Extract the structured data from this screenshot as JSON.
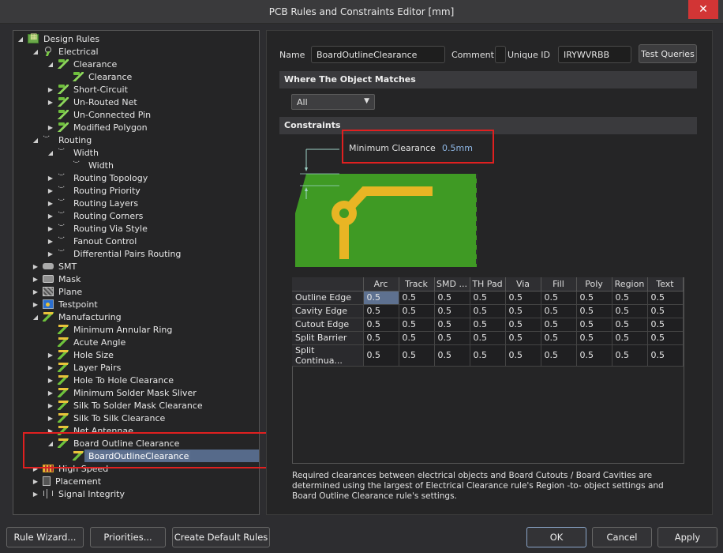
{
  "window": {
    "title": "PCB Rules and Constraints Editor [mm]",
    "close_glyph": "✕"
  },
  "tree": {
    "items": [
      {
        "label": "Design Rules",
        "icon": "design-rules-icon",
        "arrow": "◢"
      },
      {
        "label": "Electrical",
        "icon": "electrical-icon",
        "arrow": "◢"
      },
      {
        "label": "Clearance",
        "icon": "rule-icon",
        "arrow": "◢"
      },
      {
        "label": "Clearance",
        "icon": "rule-icon",
        "arrow": ""
      },
      {
        "label": "Short-Circuit",
        "icon": "rule-icon",
        "arrow": "▶"
      },
      {
        "label": "Un-Routed Net",
        "icon": "rule-icon",
        "arrow": "▶"
      },
      {
        "label": "Un-Connected Pin",
        "icon": "rule-icon",
        "arrow": ""
      },
      {
        "label": "Modified Polygon",
        "icon": "rule-icon",
        "arrow": "▶"
      },
      {
        "label": "Routing",
        "icon": "routing-icon",
        "arrow": "◢"
      },
      {
        "label": "Width",
        "icon": "routing-icon",
        "arrow": "◢"
      },
      {
        "label": "Width",
        "icon": "routing-icon",
        "arrow": ""
      },
      {
        "label": "Routing Topology",
        "icon": "routing-icon",
        "arrow": "▶"
      },
      {
        "label": "Routing Priority",
        "icon": "routing-icon",
        "arrow": "▶"
      },
      {
        "label": "Routing Layers",
        "icon": "routing-icon",
        "arrow": "▶"
      },
      {
        "label": "Routing Corners",
        "icon": "routing-icon",
        "arrow": "▶"
      },
      {
        "label": "Routing Via Style",
        "icon": "routing-icon",
        "arrow": "▶"
      },
      {
        "label": "Fanout Control",
        "icon": "routing-icon",
        "arrow": "▶"
      },
      {
        "label": "Differential Pairs Routing",
        "icon": "routing-icon",
        "arrow": "▶"
      },
      {
        "label": "SMT",
        "icon": "smt-icon",
        "arrow": "▶"
      },
      {
        "label": "Mask",
        "icon": "mask-icon",
        "arrow": "▶"
      },
      {
        "label": "Plane",
        "icon": "plane-icon",
        "arrow": "▶"
      },
      {
        "label": "Testpoint",
        "icon": "testpoint-icon",
        "arrow": "▶"
      },
      {
        "label": "Manufacturing",
        "icon": "manufacturing-icon",
        "arrow": "◢"
      },
      {
        "label": "Minimum Annular Ring",
        "icon": "manufacturing-rule-icon",
        "arrow": ""
      },
      {
        "label": "Acute Angle",
        "icon": "manufacturing-rule-icon",
        "arrow": ""
      },
      {
        "label": "Hole Size",
        "icon": "manufacturing-rule-icon",
        "arrow": "▶"
      },
      {
        "label": "Layer Pairs",
        "icon": "manufacturing-rule-icon",
        "arrow": "▶"
      },
      {
        "label": "Hole To Hole Clearance",
        "icon": "manufacturing-rule-icon",
        "arrow": "▶"
      },
      {
        "label": "Minimum Solder Mask Sliver",
        "icon": "manufacturing-rule-icon",
        "arrow": "▶"
      },
      {
        "label": "Silk To Solder Mask Clearance",
        "icon": "manufacturing-rule-icon",
        "arrow": "▶"
      },
      {
        "label": "Silk To Silk Clearance",
        "icon": "manufacturing-rule-icon",
        "arrow": "▶"
      },
      {
        "label": "Net Antennae",
        "icon": "manufacturing-rule-icon",
        "arrow": "▶"
      },
      {
        "label": "Board Outline Clearance",
        "icon": "manufacturing-rule-icon",
        "arrow": "◢"
      },
      {
        "label": "BoardOutlineClearance",
        "icon": "manufacturing-rule-icon",
        "arrow": ""
      },
      {
        "label": "High Speed",
        "icon": "high-speed-icon",
        "arrow": "▶"
      },
      {
        "label": "Placement",
        "icon": "placement-icon",
        "arrow": "▶"
      },
      {
        "label": "Signal Integrity",
        "icon": "signal-integrity-icon",
        "arrow": "▶"
      }
    ]
  },
  "rule": {
    "name_label": "Name",
    "name_value": "BoardOutlineClearance",
    "comment_label": "Comment",
    "comment_value": "",
    "uid_label": "Unique ID",
    "uid_value": "IRYWVRBB",
    "test_queries": "Test Queries"
  },
  "match": {
    "header": "Where The Object Matches",
    "selected": "All"
  },
  "constraints": {
    "header": "Constraints",
    "min_clearance_label": "Minimum Clearance",
    "min_clearance_value": "0.5mm"
  },
  "grid": {
    "columns": [
      "",
      "Arc",
      "Track",
      "SMD ...",
      "TH Pad",
      "Via",
      "Fill",
      "Poly",
      "Region",
      "Text"
    ],
    "rows": [
      {
        "name": "Outline Edge",
        "values": [
          "0.5",
          "0.5",
          "0.5",
          "0.5",
          "0.5",
          "0.5",
          "0.5",
          "0.5",
          "0.5"
        ]
      },
      {
        "name": "Cavity Edge",
        "values": [
          "0.5",
          "0.5",
          "0.5",
          "0.5",
          "0.5",
          "0.5",
          "0.5",
          "0.5",
          "0.5"
        ]
      },
      {
        "name": "Cutout Edge",
        "values": [
          "0.5",
          "0.5",
          "0.5",
          "0.5",
          "0.5",
          "0.5",
          "0.5",
          "0.5",
          "0.5"
        ]
      },
      {
        "name": "Split Barrier",
        "values": [
          "0.5",
          "0.5",
          "0.5",
          "0.5",
          "0.5",
          "0.5",
          "0.5",
          "0.5",
          "0.5"
        ]
      },
      {
        "name": "Split Continua...",
        "values": [
          "0.5",
          "0.5",
          "0.5",
          "0.5",
          "0.5",
          "0.5",
          "0.5",
          "0.5",
          "0.5"
        ]
      }
    ]
  },
  "description": "Required clearances between electrical objects and Board Cutouts / Board Cavities are determined using the largest of Electrical Clearance rule's Region -to- object settings and Board Outline Clearance rule's settings.",
  "buttons": {
    "rule_wizard": "Rule Wizard...",
    "priorities": "Priorities...",
    "create_default": "Create Default Rules",
    "ok": "OK",
    "cancel": "Cancel",
    "apply": "Apply"
  },
  "colors": {
    "pcb_green": "#3f9a24",
    "track_yellow": "#e8b524",
    "highlight_red": "#e02020",
    "selection": "#5e7190"
  }
}
